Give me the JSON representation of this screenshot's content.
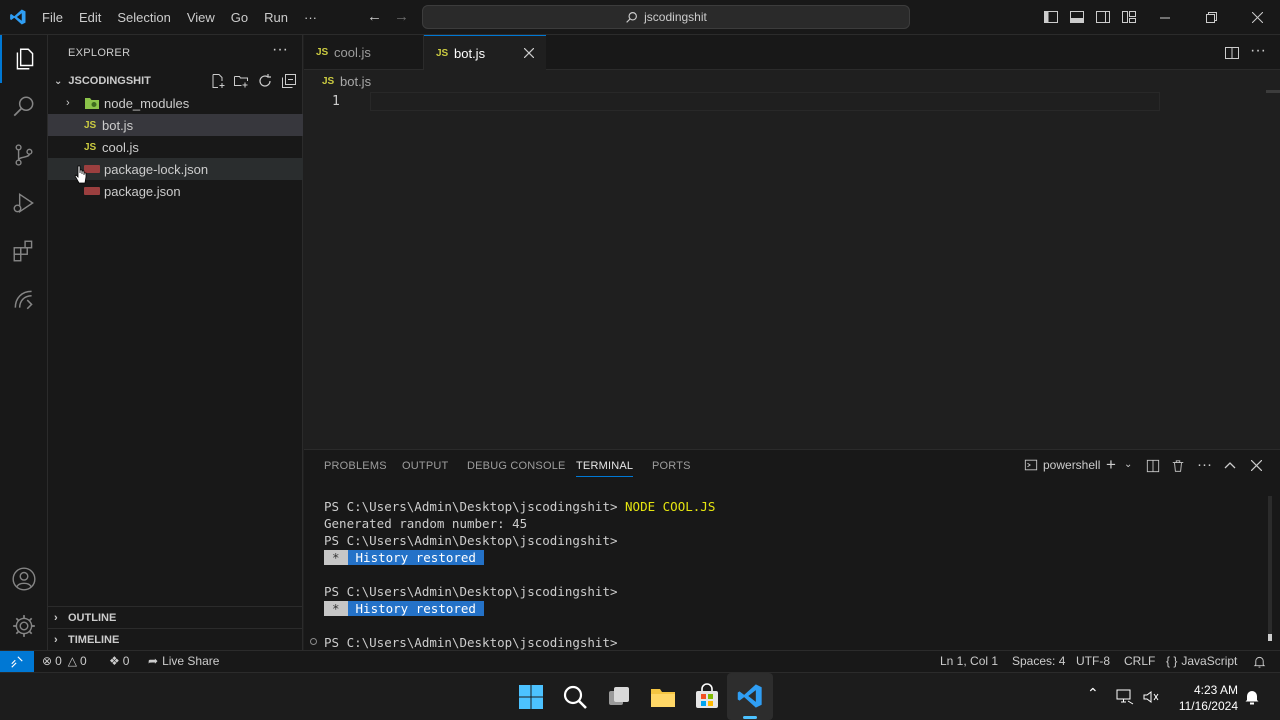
{
  "window": {
    "menu": [
      "File",
      "Edit",
      "Selection",
      "View",
      "Go",
      "Run",
      "···"
    ],
    "search_text": "jscodingshit"
  },
  "sidebar": {
    "title": "EXPLORER",
    "folder": "JSCODINGSHIT",
    "items": [
      {
        "label": "node_modules",
        "type": "folder"
      },
      {
        "label": "bot.js",
        "type": "js"
      },
      {
        "label": "cool.js",
        "type": "js"
      },
      {
        "label": "package-lock.json",
        "type": "json"
      },
      {
        "label": "package.json",
        "type": "json"
      }
    ],
    "outline": "OUTLINE",
    "timeline": "TIMELINE"
  },
  "tabs": [
    {
      "icon": "JS",
      "label": "cool.js"
    },
    {
      "icon": "JS",
      "label": "bot.js"
    }
  ],
  "editor": {
    "breadcrumb_icon": "JS",
    "breadcrumb": "bot.js",
    "line_number": "1"
  },
  "panel": {
    "tabs": [
      "PROBLEMS",
      "OUTPUT",
      "DEBUG CONSOLE",
      "TERMINAL",
      "PORTS"
    ],
    "shell": "powershell",
    "terminal": {
      "prompt": "PS C:\\Users\\Admin\\Desktop\\jscodingshit>",
      "command": "NODE COOL.JS",
      "output": "Generated random number: 45",
      "history_star": "*",
      "history_msg": "History restored"
    }
  },
  "statusbar": {
    "errors": "0",
    "warnings": "0",
    "ports": "0",
    "live_share": "Live Share",
    "position": "Ln 1, Col 1",
    "spaces": "Spaces: 4",
    "encoding": "UTF-8",
    "eol": "CRLF",
    "language": "JavaScript"
  },
  "taskbar": {
    "time": "4:23 AM",
    "date": "11/16/2024"
  },
  "colors": {
    "accent": "#0078d4",
    "js_icon": "#cbcb41",
    "history_bg": "#2472c8"
  }
}
